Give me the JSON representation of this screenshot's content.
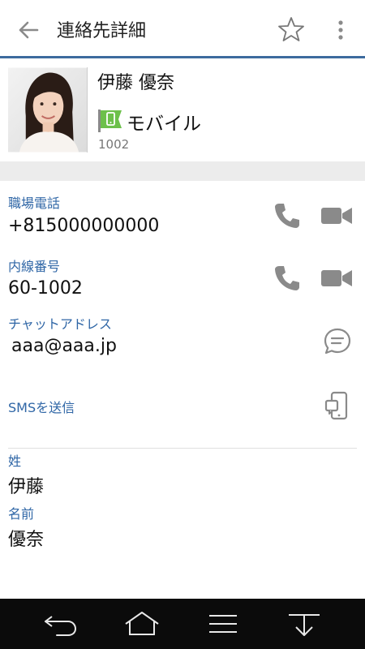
{
  "appbar": {
    "title": "連絡先詳細",
    "back_icon": "arrow-left-icon",
    "favorite_icon": "star-outline-icon",
    "more_icon": "more-vertical-icon"
  },
  "contact": {
    "name": "伊藤 優奈",
    "type_label": "モバイル",
    "type_icon": "mobile-badge-icon",
    "extension": "1002"
  },
  "fields": {
    "work_phone": {
      "label": "職場電話",
      "value": "+815000000000"
    },
    "extension": {
      "label": "内線番号",
      "value": "60-1002"
    },
    "chat": {
      "label": "チャットアドレス",
      "value": "aaa@aaa.jp"
    },
    "sms": {
      "label": "SMSを送信"
    },
    "last_name": {
      "label": "姓",
      "value": "伊藤"
    },
    "first_name": {
      "label": "名前",
      "value": "優奈"
    }
  },
  "colors": {
    "accent": "#3d6b9e",
    "label_blue": "#2f66a6",
    "icon_gray": "#8a8a8a",
    "badge_green": "#6cc04a",
    "navbar_bg": "#0b0b0b"
  },
  "navbar": {
    "icons": [
      "back-icon",
      "home-icon",
      "menu-icon",
      "hide-keyboard-icon"
    ]
  }
}
